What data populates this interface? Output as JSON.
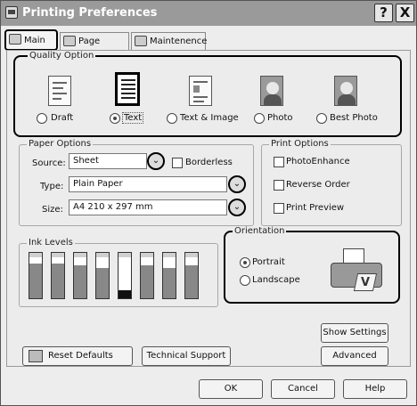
{
  "window": {
    "title": "Printing Preferences",
    "help_btn": "?",
    "close_btn": "X"
  },
  "tabs": [
    {
      "label": "Main"
    },
    {
      "label": "Page Layout"
    },
    {
      "label": "Maintenence"
    }
  ],
  "quality": {
    "legend": "Quality Option",
    "options": [
      {
        "label": "Draft",
        "selected": false
      },
      {
        "label": "Text",
        "selected": true
      },
      {
        "label": "Text & Image",
        "selected": false
      },
      {
        "label": "Photo",
        "selected": false
      },
      {
        "label": "Best Photo",
        "selected": false
      }
    ]
  },
  "paper": {
    "legend": "Paper Options",
    "source_label": "Source:",
    "source_value": "Sheet",
    "borderless_label": "Borderless",
    "type_label": "Type:",
    "type_value": "Plain Paper",
    "size_label": "Size:",
    "size_value": "A4 210 x 297 mm"
  },
  "print_options": {
    "legend": "Print Options",
    "photo_enhance": "PhotoEnhance",
    "reverse_order": "Reverse Order",
    "print_preview": "Print Preview"
  },
  "ink": {
    "legend": "Ink Levels",
    "levels": [
      0.85,
      0.85,
      0.8,
      0.75,
      0.2,
      0.8,
      0.75,
      0.8
    ]
  },
  "orientation": {
    "legend": "Orientation",
    "portrait": "Portrait",
    "landscape": "Landscape",
    "selected": "Portrait"
  },
  "buttons": {
    "show_settings": "Show Settings",
    "reset_defaults": "Reset Defaults",
    "technical_support": "Technical Support",
    "advanced": "Advanced",
    "ok": "OK",
    "cancel": "Cancel",
    "help": "Help"
  }
}
